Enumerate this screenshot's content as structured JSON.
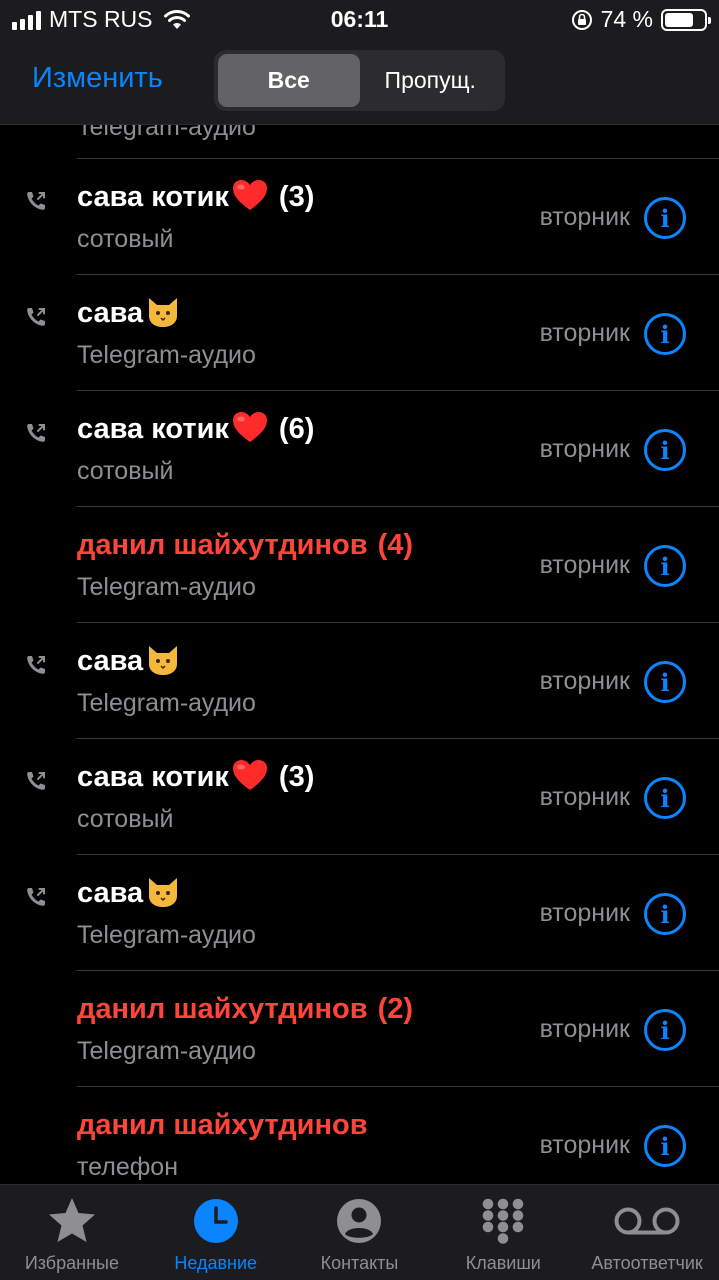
{
  "status_bar": {
    "carrier": "MTS RUS",
    "time": "06:11",
    "battery_percent": "74 %",
    "battery_level": 0.74
  },
  "nav": {
    "edit_label": "Изменить",
    "segments": [
      "Все",
      "Пропущ."
    ],
    "selected_segment": 0
  },
  "partial_row": {
    "type": "Telegram-аудио"
  },
  "calls": [
    {
      "name": "сава котик",
      "emoji": "heart",
      "count": "(3)",
      "type": "сотовый",
      "date": "вторник",
      "missed": false,
      "outgoing": true
    },
    {
      "name": "сава",
      "emoji": "cat",
      "count": "",
      "type": "Telegram-аудио",
      "date": "вторник",
      "missed": false,
      "outgoing": true
    },
    {
      "name": "сава котик",
      "emoji": "heart",
      "count": "(6)",
      "type": "сотовый",
      "date": "вторник",
      "missed": false,
      "outgoing": true
    },
    {
      "name": "данил шайхутдинов",
      "emoji": "",
      "count": "(4)",
      "type": "Telegram-аудио",
      "date": "вторник",
      "missed": true,
      "outgoing": false
    },
    {
      "name": "сава",
      "emoji": "cat",
      "count": "",
      "type": "Telegram-аудио",
      "date": "вторник",
      "missed": false,
      "outgoing": true
    },
    {
      "name": "сава котик",
      "emoji": "heart",
      "count": "(3)",
      "type": "сотовый",
      "date": "вторник",
      "missed": false,
      "outgoing": true
    },
    {
      "name": "сава",
      "emoji": "cat",
      "count": "",
      "type": "Telegram-аудио",
      "date": "вторник",
      "missed": false,
      "outgoing": true
    },
    {
      "name": "данил шайхутдинов",
      "emoji": "",
      "count": "(2)",
      "type": "Telegram-аудио",
      "date": "вторник",
      "missed": true,
      "outgoing": false
    },
    {
      "name": "данил шайхутдинов",
      "emoji": "",
      "count": "",
      "type": "телефон",
      "date": "вторник",
      "missed": true,
      "outgoing": false
    }
  ],
  "tabs": [
    {
      "label": "Избранные",
      "icon": "star-icon",
      "active": false
    },
    {
      "label": "Недавние",
      "icon": "clock-icon",
      "active": true
    },
    {
      "label": "Контакты",
      "icon": "person-icon",
      "active": false
    },
    {
      "label": "Клавиши",
      "icon": "keypad-icon",
      "active": false
    },
    {
      "label": "Автоответчик",
      "icon": "voicemail-icon",
      "active": false
    }
  ],
  "colors": {
    "accent": "#0a84ff",
    "missed": "#ff453a",
    "secondary_text": "#8e8e93",
    "bar_background": "#1c1c1e"
  }
}
